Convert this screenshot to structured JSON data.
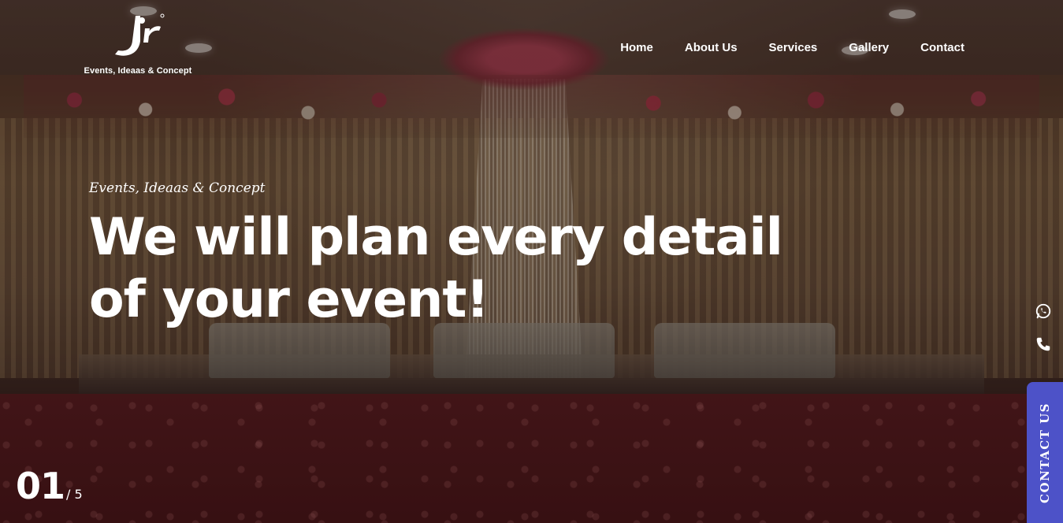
{
  "brand": {
    "logo_text": "Events, Ideaas & Concept",
    "logo_icon": "jr-logo"
  },
  "nav": {
    "items": [
      "Home",
      "About Us",
      "Services",
      "Gallery",
      "Contact"
    ]
  },
  "hero": {
    "tagline": "Events, Ideaas & Concept",
    "headline_line1": "We will plan every detail",
    "headline_line2": "of your event!"
  },
  "slider": {
    "current": "01",
    "total": "/ 5"
  },
  "side_icons": [
    "whatsapp-icon",
    "phone-icon"
  ],
  "contact_tab": {
    "label": "CONTACT US"
  },
  "colors": {
    "accent": "#4d52c8",
    "text": "#ffffff"
  }
}
